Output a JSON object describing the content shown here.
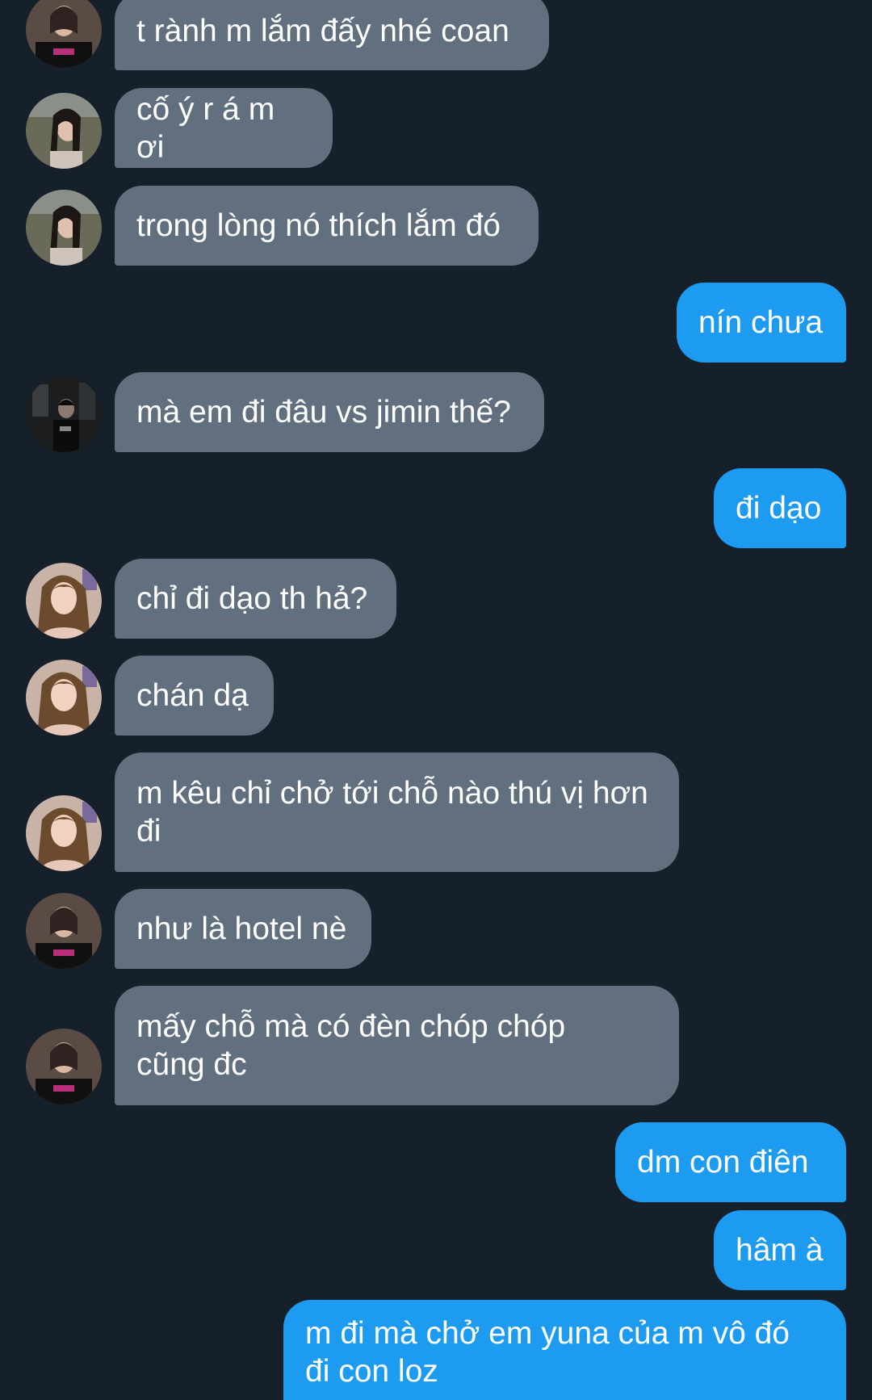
{
  "conversation": {
    "messages": [
      {
        "side": "in",
        "avatar": "avatar-a",
        "text": "t rành m lắm đấy nhé coan"
      },
      {
        "side": "in",
        "avatar": "avatar-b",
        "text": "cố ý r á m ơi"
      },
      {
        "side": "in",
        "avatar": "avatar-b",
        "text": "trong lòng nó thích lắm đó"
      },
      {
        "side": "out",
        "text": "nín chưa"
      },
      {
        "side": "in",
        "avatar": "avatar-c",
        "text": "mà em đi đâu vs jimin thế?"
      },
      {
        "side": "out",
        "text": "đi dạo"
      },
      {
        "side": "in",
        "avatar": "avatar-d",
        "text": "chỉ đi dạo th hả?"
      },
      {
        "side": "in",
        "avatar": "avatar-d",
        "text": "chán dạ"
      },
      {
        "side": "in",
        "avatar": "avatar-d",
        "text": "m kêu chỉ chở tới chỗ nào thú vị hơn\nđi"
      },
      {
        "side": "in",
        "avatar": "avatar-a",
        "text": "như là hotel nè"
      },
      {
        "side": "in",
        "avatar": "avatar-a",
        "text": "mấy chỗ mà có đèn chóp chóp\ncũng đc"
      },
      {
        "side": "out",
        "text": "dm con điên"
      },
      {
        "side": "out",
        "text": "hâm à"
      },
      {
        "side": "out",
        "text": "m đi mà chở em yuna của m vô đó\nđi con loz"
      }
    ]
  },
  "colors": {
    "background": "#16202b",
    "incoming_bubble": "#616f7e",
    "outgoing_bubble": "#1d9bf0",
    "text": "#ffffff"
  }
}
